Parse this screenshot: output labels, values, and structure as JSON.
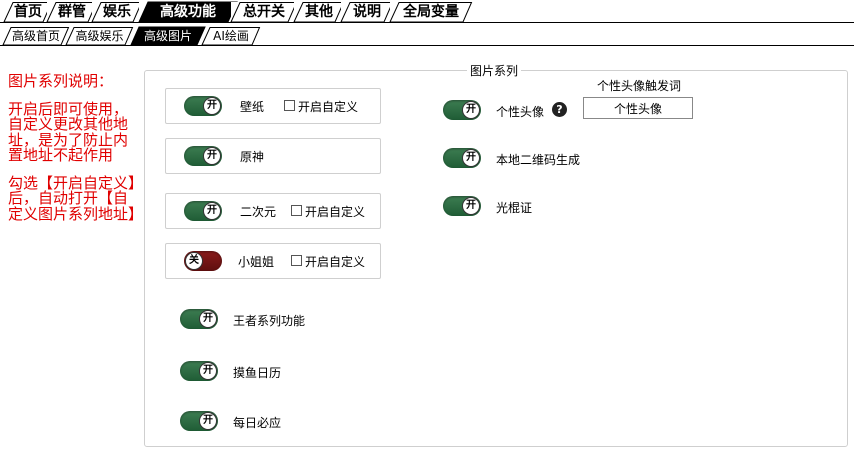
{
  "tabs_main": [
    {
      "label": "首页",
      "active": false
    },
    {
      "label": "群管",
      "active": false
    },
    {
      "label": "娱乐",
      "active": false
    },
    {
      "label": "高级功能",
      "active": true
    },
    {
      "label": "总开关",
      "active": false
    },
    {
      "label": "其他",
      "active": false
    },
    {
      "label": "说明",
      "active": false
    },
    {
      "label": "全局变量",
      "active": false
    }
  ],
  "tabs_sub": [
    {
      "label": "高级首页",
      "active": false
    },
    {
      "label": "高级娱乐",
      "active": false
    },
    {
      "label": "高级图片",
      "active": true
    },
    {
      "label": "AI绘画",
      "active": false
    }
  ],
  "description": {
    "title": "图片系列说明：",
    "p1": "开启后即可使用，自定义更改其他地址，是为了防止内置地址不起作用",
    "p2": "勾选【开启自定义】后，自动打开【自定义图片系列地址】"
  },
  "panel": {
    "legend": "图片系列",
    "custom_label": "开启自定义",
    "toggle_on": "开",
    "toggle_off": "关",
    "items_left": [
      {
        "label": "壁纸",
        "state": "on",
        "custom": false
      },
      {
        "label": "原神",
        "state": "on"
      },
      {
        "label": "二次元",
        "state": "on",
        "custom": false
      },
      {
        "label": "小姐姐",
        "state": "off",
        "custom": false
      },
      {
        "label": "王者系列功能",
        "state": "on"
      },
      {
        "label": "摸鱼日历",
        "state": "on"
      },
      {
        "label": "每日必应",
        "state": "on"
      }
    ],
    "items_right": [
      {
        "label": "个性头像",
        "state": "on"
      },
      {
        "label": "本地二维码生成",
        "state": "on"
      },
      {
        "label": "光棍证",
        "state": "on"
      }
    ],
    "trigger_label": "个性头像触发词",
    "trigger_value": "个性头像",
    "help_icon": "question-circle-icon"
  },
  "colors": {
    "toggle_on": "#2e6e45",
    "toggle_off": "#7a1515",
    "desc_text": "#e00000"
  }
}
